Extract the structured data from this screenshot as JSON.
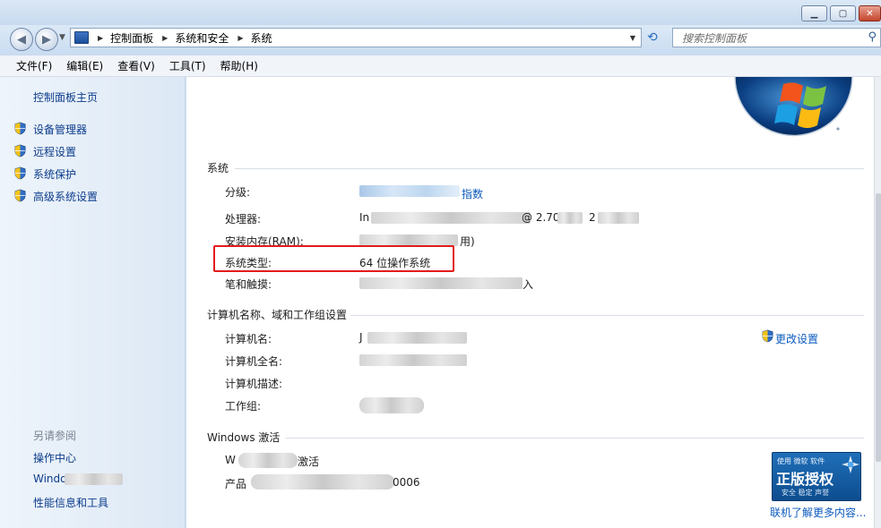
{
  "address": {
    "crumbs": [
      "控制面板",
      "系统和安全",
      "系统"
    ],
    "search_placeholder": "搜索控制面板"
  },
  "menu": {
    "items": [
      "文件(F)",
      "编辑(E)",
      "查看(V)",
      "工具(T)",
      "帮助(H)"
    ]
  },
  "sidebar": {
    "home": "控制面板主页",
    "items": [
      "设备管理器",
      "远程设置",
      "系统保护",
      "高级系统设置"
    ],
    "see_also_title": "另请参阅",
    "see_also": [
      "操作中心",
      "Windo",
      "性能信息和工具"
    ]
  },
  "system": {
    "title": "系统",
    "rating_label": "分级:",
    "rating_suffix": "指数",
    "cpu_label": "处理器:",
    "cpu_prefix": "In",
    "cpu_mid": "@ 2.70",
    "cpu_tail": "2",
    "ram_label": "安装内存(RAM):",
    "ram_suffix": "用)",
    "type_label": "系统类型:",
    "type_value": "64 位操作系统",
    "pen_label": "笔和触摸:",
    "pen_suffix": "入"
  },
  "computer": {
    "title": "计算机名称、域和工作组设置",
    "name_label": "计算机名:",
    "name_prefix": "J",
    "fullname_label": "计算机全名:",
    "desc_label": "计算机描述:",
    "workgroup_label": "工作组:",
    "change_link": "更改设置"
  },
  "activation": {
    "title": "Windows 激活",
    "status_prefix": "W",
    "status_suffix": "激活",
    "product_label": "产品",
    "product_suffix": "0006",
    "badge_top": "使用 微软 软件",
    "badge_main": "正版授权",
    "badge_sub": "安全 稳定 声誉",
    "more_link": "联机了解更多内容..."
  }
}
